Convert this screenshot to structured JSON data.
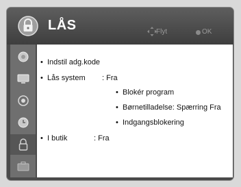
{
  "header": {
    "title": "LÅS",
    "hint_move": "Flyt",
    "hint_ok": "OK"
  },
  "sidebar": {
    "items": [
      {
        "icon": "picture-icon"
      },
      {
        "icon": "tv-screen-icon"
      },
      {
        "icon": "speaker-icon"
      },
      {
        "icon": "clock-icon"
      },
      {
        "icon": "lock-icon",
        "active": true
      },
      {
        "icon": "briefcase-icon"
      }
    ]
  },
  "menu": {
    "set_password": "Indstil adg.kode",
    "lock_system_label": "Lås system",
    "lock_system_value": ": Fra",
    "block_program": "Blokér program",
    "parental_rating": "Børnetilladelse: Spærring Fra",
    "input_block": "Indgangsblokering",
    "in_store_label": "I butik",
    "in_store_value": ": Fra"
  },
  "colors": {
    "frame": "#4a4a4a",
    "sidebar": "#6f6f6f",
    "sidebar_active": "#565656",
    "content": "#ffffff",
    "title_text": "#ffffff"
  }
}
